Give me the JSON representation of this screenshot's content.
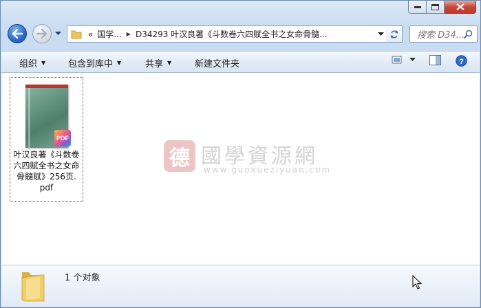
{
  "window": {
    "caption": {
      "minimize_icon": "minimize-icon",
      "maximize_icon": "maximize-icon",
      "close_icon": "close-icon"
    }
  },
  "navigation": {
    "back_icon": "arrow-left-icon",
    "forward_icon": "arrow-right-icon",
    "breadcrumb": {
      "overflow": "«",
      "segments": [
        "国学...",
        "D34293 叶汉良著《斗数卷六四赋全书之女命骨髓..."
      ]
    },
    "search_placeholder": "搜索 D34..."
  },
  "toolbar": {
    "organize": "组织",
    "include_in_library": "包含到库中",
    "share": "共享",
    "new_folder": "新建文件夹"
  },
  "files": [
    {
      "name_lines": [
        "叶汉良著《斗数卷",
        "六四赋全书之女命",
        "骨髓赋》256页.",
        "pdf"
      ],
      "badge": "PDF",
      "cover_label": "PDF"
    }
  ],
  "watermark": {
    "title": "國學資源網",
    "url": "www.guoxueziyuan.com"
  },
  "status": {
    "object_count": "1 个对象"
  },
  "colors": {
    "accent_blue": "#2a6bc6",
    "close_red": "#c2392a",
    "watermark_red": "#e8b8b8"
  }
}
